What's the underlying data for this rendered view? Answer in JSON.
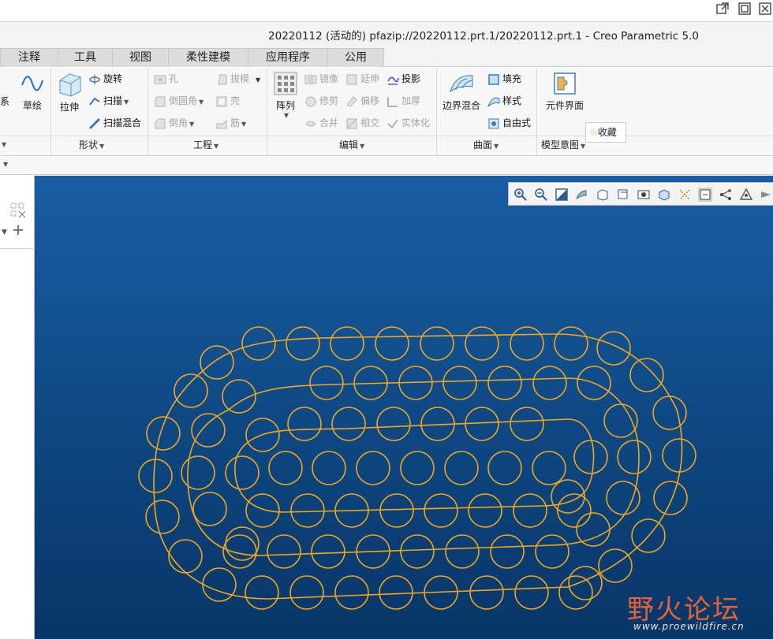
{
  "window": {
    "title": "20220112 (活动的) pfazip://20220112.prt.1/20220112.prt.1 - Creo Parametric 5.0",
    "controls": [
      "popout-icon",
      "restore-icon",
      "close-icon"
    ]
  },
  "tabs": [
    "注释",
    "工具",
    "视图",
    "柔性建模",
    "应用程序",
    "公用"
  ],
  "ribbon": {
    "left_partial": {
      "sketch_label": "草绘",
      "coord_label": "系"
    },
    "shape": {
      "group_label": "形状",
      "extrude": "拉伸",
      "revolve": "旋转",
      "sweep": "扫描",
      "swept_blend": "扫描混合"
    },
    "engineering": {
      "group_label": "工程",
      "hole": "孔",
      "round": "倒圆角",
      "chamfer": "倒角",
      "draft": "拔模",
      "shell": "壳",
      "rib": "筋"
    },
    "editing": {
      "group_label": "编辑",
      "pattern": "阵列",
      "mirror": "镜像",
      "trim": "修剪",
      "merge": "合并",
      "extend": "延伸",
      "offset": "偏移",
      "intersect": "相交",
      "project": "投影",
      "thicken": "加厚",
      "solidify": "实体化"
    },
    "surfaces": {
      "group_label": "曲面",
      "boundary_blend": "边界混合",
      "fill": "填充",
      "style": "样式",
      "freestyle": "自由式"
    },
    "model_intent": {
      "group_label": "模型意图",
      "component_interface": "元件界面"
    }
  },
  "favorites_popup": "收藏",
  "graphics_toolbar": [
    "zoom-in-icon",
    "zoom-out-icon",
    "refit-icon",
    "reorient-icon",
    "saved-views-icon",
    "display-style-icon",
    "view-manager-icon",
    "perspective-icon",
    "spin-center-icon",
    "annotation-display-icon",
    "datum-display-icon",
    "datum-planes-icon",
    "more-icon"
  ],
  "colors": {
    "curve": "#f0a81e",
    "background_top": "#1a5da4",
    "background_bottom": "#083567"
  },
  "watermark": {
    "title": "野火论坛",
    "url": "www.proewildfire.cn"
  }
}
